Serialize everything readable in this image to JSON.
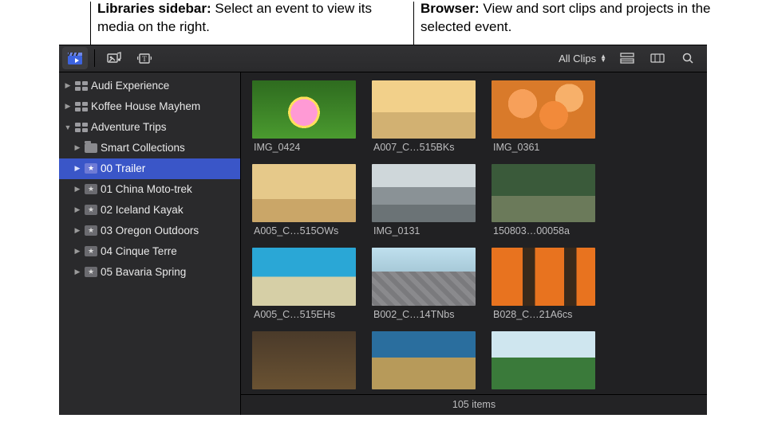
{
  "callouts": {
    "libraries_title": "Libraries sidebar:",
    "libraries_text": " Select an event to view its media on the right.",
    "browser_title": "Browser:",
    "browser_text": " View and sort clips and projects in the selected event."
  },
  "toolbar": {
    "allclips_label": "All Clips"
  },
  "sidebar": {
    "items": [
      {
        "label": "Audi Experience"
      },
      {
        "label": "Koffee House Mayhem"
      },
      {
        "label": "Adventure Trips"
      },
      {
        "label": "Smart Collections"
      },
      {
        "label": "00 Trailer"
      },
      {
        "label": "01 China Moto-trek"
      },
      {
        "label": "02 Iceland Kayak"
      },
      {
        "label": "03 Oregon Outdoors"
      },
      {
        "label": "04 Cinque Terre"
      },
      {
        "label": "05 Bavaria Spring"
      }
    ]
  },
  "clips": [
    {
      "label": "IMG_0424"
    },
    {
      "label": "A007_C…515BKs"
    },
    {
      "label": "IMG_0361"
    },
    {
      "label": "A005_C…515OWs"
    },
    {
      "label": "IMG_0131"
    },
    {
      "label": "150803…00058a"
    },
    {
      "label": "A005_C…515EHs"
    },
    {
      "label": "B002_C…14TNbs"
    },
    {
      "label": "B028_C…21A6cs"
    },
    {
      "label": ""
    },
    {
      "label": ""
    },
    {
      "label": ""
    }
  ],
  "footer": {
    "count_label": "105 items"
  }
}
